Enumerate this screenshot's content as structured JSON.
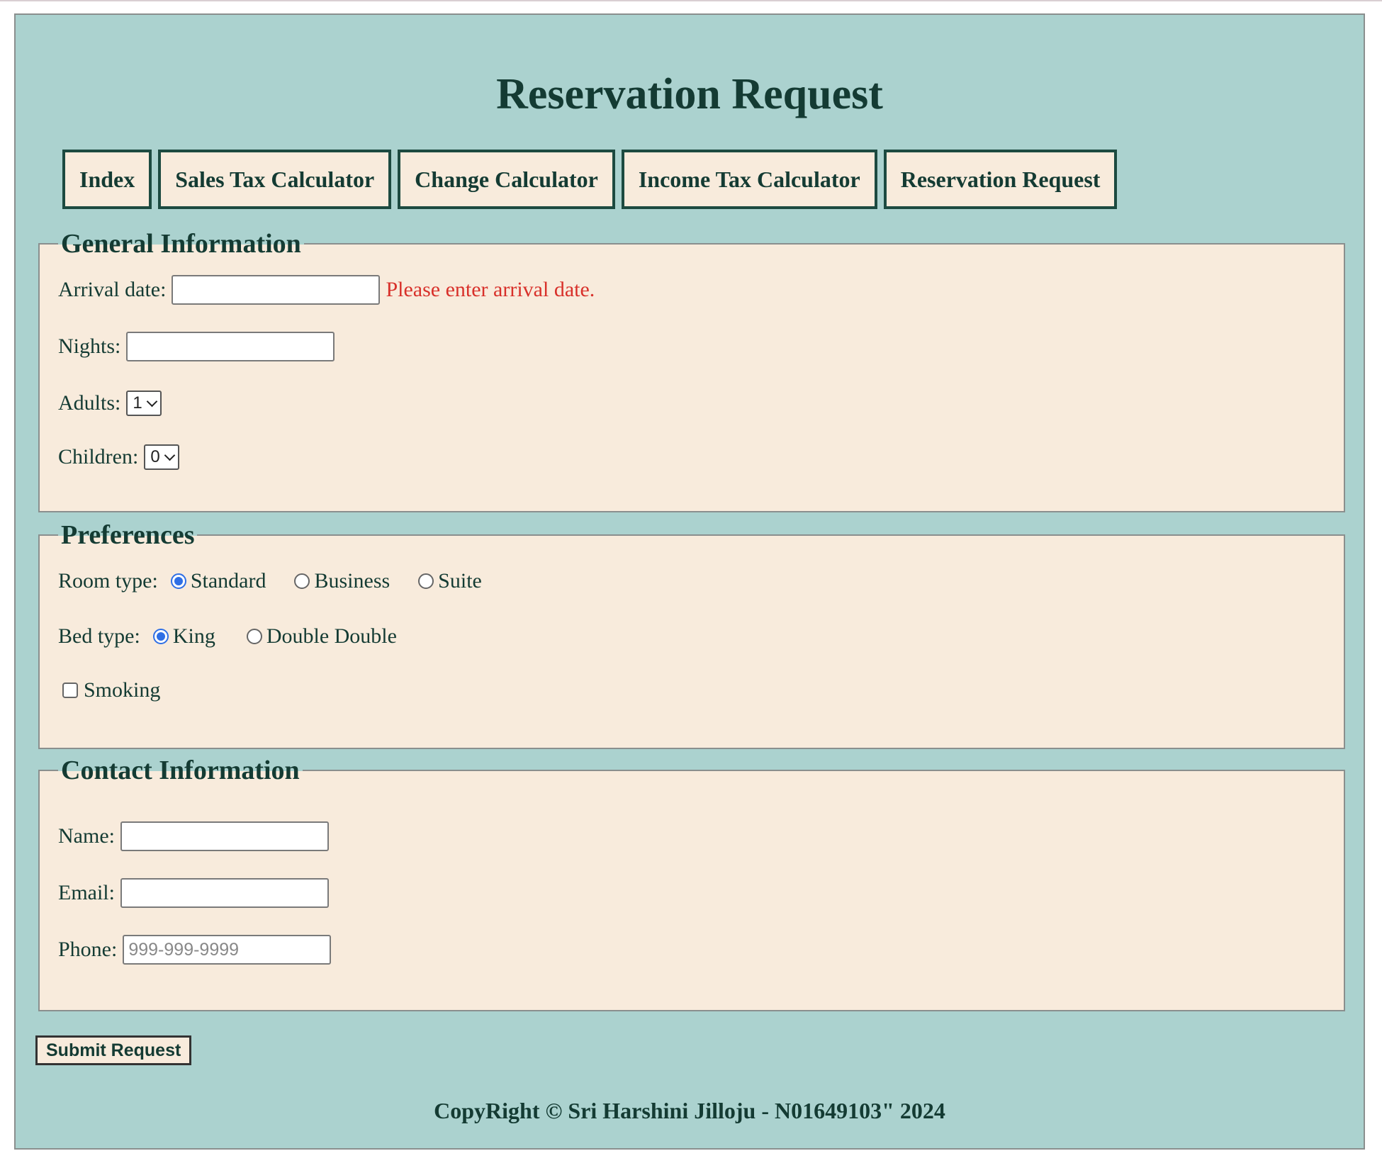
{
  "title": "Reservation Request",
  "nav": [
    {
      "label": "Index"
    },
    {
      "label": "Sales Tax Calculator"
    },
    {
      "label": "Change Calculator"
    },
    {
      "label": "Income Tax Calculator"
    },
    {
      "label": "Reservation Request"
    }
  ],
  "general": {
    "legend": "General Information",
    "arrival_label": "Arrival date:",
    "arrival_value": "",
    "arrival_error": "Please enter arrival date.",
    "nights_label": "Nights:",
    "nights_value": "",
    "adults_label": "Adults:",
    "adults_selected": "1",
    "children_label": "Children:",
    "children_selected": "0"
  },
  "preferences": {
    "legend": "Preferences",
    "room_label": "Room type:",
    "room_options": [
      {
        "label": "Standard",
        "checked": true
      },
      {
        "label": "Business",
        "checked": false
      },
      {
        "label": "Suite",
        "checked": false
      }
    ],
    "bed_label": "Bed type:",
    "bed_options": [
      {
        "label": "King",
        "checked": true
      },
      {
        "label": "Double Double",
        "checked": false
      }
    ],
    "smoking_label": "Smoking",
    "smoking_checked": false
  },
  "contact": {
    "legend": "Contact Information",
    "name_label": "Name:",
    "name_value": "",
    "email_label": "Email:",
    "email_value": "",
    "phone_label": "Phone:",
    "phone_placeholder": "999-999-9999"
  },
  "submit_label": "Submit Request",
  "footer": "CopyRight © Sri Harshini Jilloju - N01649103\" 2024",
  "colors": {
    "page_bg": "#abd2cf",
    "panel_bg": "#f8ebdc",
    "text": "#143b33",
    "error": "#d8302a",
    "radio_accent": "#2f6fe5"
  }
}
